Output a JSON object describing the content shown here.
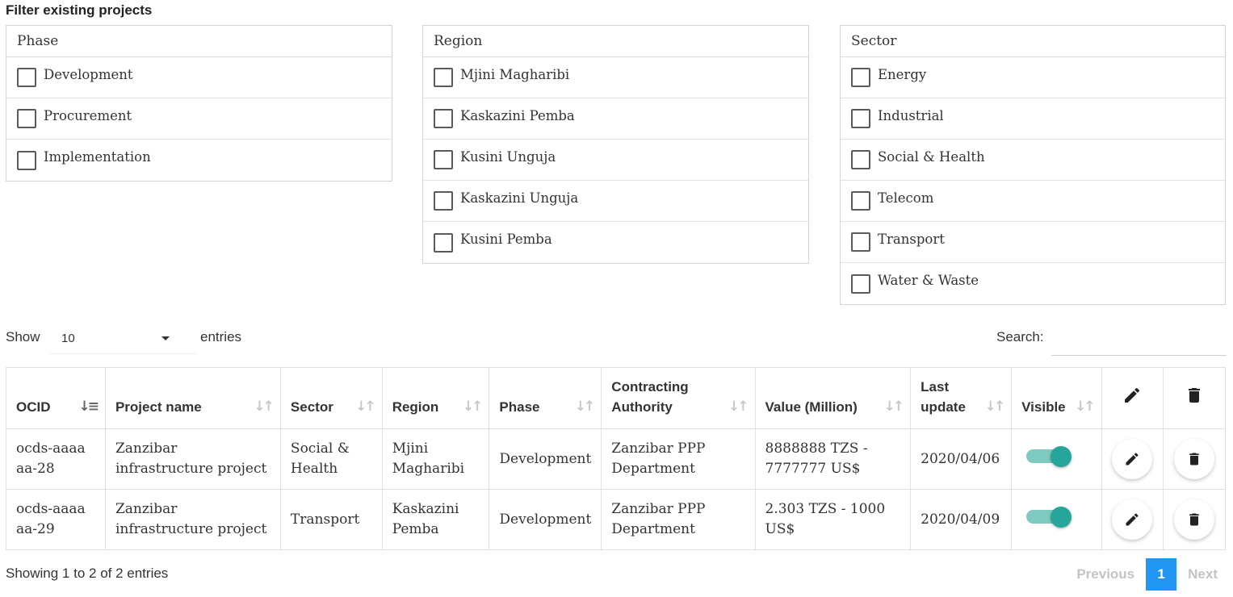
{
  "filter": {
    "title": "Filter existing projects",
    "phase": {
      "header": "Phase",
      "options": [
        "Development",
        "Procurement",
        "Implementation"
      ]
    },
    "region": {
      "header": "Region",
      "options": [
        "Mjini Magharibi",
        "Kaskazini Pemba",
        "Kusini Unguja",
        "Kaskazini Unguja",
        "Kusini Pemba"
      ]
    },
    "sector": {
      "header": "Sector",
      "options": [
        "Energy",
        "Industrial",
        "Social & Health",
        "Telecom",
        "Transport",
        "Water & Waste"
      ]
    }
  },
  "controls": {
    "show_label": "Show",
    "length_value": "10",
    "entries_label": "entries",
    "search_label": "Search:",
    "search_value": ""
  },
  "table": {
    "columns": [
      "OCID",
      "Project name",
      "Sector",
      "Region",
      "Phase",
      "Contracting Authority",
      "Value (Million)",
      "Last update",
      "Visible"
    ],
    "rows": [
      {
        "ocid": "ocds-aaaaaa-28",
        "name": "Zanzibar infrastructure project",
        "sector": "Social & Health",
        "region": "Mjini Magharibi",
        "phase": "Development",
        "authority": "Zanzibar PPP Department",
        "value": "8888888 TZS - 7777777 US$",
        "updated": "2020/04/06",
        "visible": true
      },
      {
        "ocid": "ocds-aaaaaa-29",
        "name": "Zanzibar infrastructure project",
        "sector": "Transport",
        "region": "Kaskazini Pemba",
        "phase": "Development",
        "authority": "Zanzibar PPP Department",
        "value": "2.303 TZS - 1000 US$",
        "updated": "2020/04/09",
        "visible": true
      }
    ]
  },
  "footer": {
    "info": "Showing 1 to 2 of 2 entries",
    "previous": "Previous",
    "page": "1",
    "next": "Next"
  },
  "colors": {
    "toggle_on": "#26a69a",
    "page_active": "#2196f3"
  },
  "icons": {
    "edit": "pencil-icon",
    "delete": "trash-icon",
    "sort": "sort-arrows-icon"
  }
}
